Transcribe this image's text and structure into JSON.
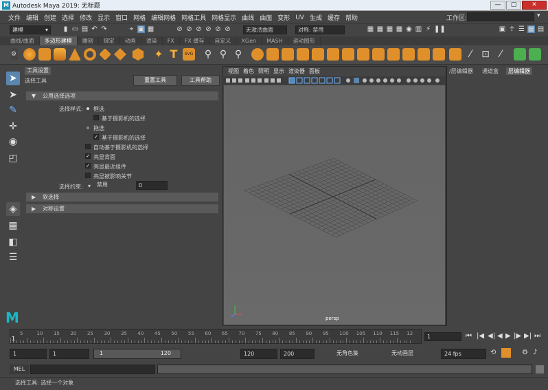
{
  "window": {
    "title": "Autodesk Maya 2019: 无标题",
    "min": "—",
    "max": "▢",
    "close": "✕"
  },
  "menubar": [
    "文件",
    "编辑",
    "创建",
    "选择",
    "修改",
    "显示",
    "窗口",
    "网格",
    "编辑网格",
    "网格工具",
    "网格显示",
    "曲线",
    "曲面",
    "变形",
    "UV",
    "生成",
    "缓存",
    "帮助"
  ],
  "workspace": {
    "label": "工作区:",
    "value": ""
  },
  "statusline": {
    "mode": "建模",
    "live_surface": "无激活曲面",
    "symmetry": "对称: 禁用"
  },
  "shelf_tabs": [
    "曲线/曲面",
    "多边形建模",
    "雕刻",
    "绑定",
    "动画",
    "渲染",
    "FX",
    "FX 缓存",
    "自定义",
    "XGen",
    "MASH",
    "运动图形"
  ],
  "shelf_active_tab": 1,
  "tool_settings": {
    "tab_label": "工具设置",
    "tool_name": "选择工具",
    "reset_button": "重置工具",
    "help_button": "工具帮助",
    "section_common": "公用选择选项",
    "selection_style_label": "选择样式:",
    "option_marquee": "框选",
    "option_camera_based_1": "基于摄影机的选择",
    "option_drag": "拖选",
    "option_camera_based_2": "基于摄影机的选择",
    "option_auto_camera": "自动基于摄影机的选择",
    "option_backface": "亮显背面",
    "option_nearest": "亮显最近组件",
    "option_affects_joints": "亮显被影响关节",
    "constraint_label": "选择约束:",
    "constraint_value": "禁用",
    "constraint_number": "0",
    "section_soft": "软选择",
    "section_symmetry": "对称设置"
  },
  "viewport": {
    "menu": [
      "视图",
      "着色",
      "照明",
      "显示",
      "渲染器",
      "面板"
    ],
    "camera_label": "persp"
  },
  "right_panel": {
    "tabs": [
      "/层编辑器",
      "通道盒",
      "层编辑器"
    ],
    "active": 2
  },
  "timeline": {
    "ticks": [
      "5",
      "10",
      "15",
      "20",
      "25",
      "30",
      "35",
      "40",
      "45",
      "50",
      "55",
      "60",
      "65",
      "70",
      "75",
      "80",
      "85",
      "90",
      "95",
      "100",
      "105",
      "110",
      "115",
      "12"
    ],
    "start_marker": "1",
    "current_frame": "1"
  },
  "range": {
    "start": "1",
    "playback_start": "1",
    "slider_left": "1",
    "slider_right": "120",
    "playback_end": "120",
    "end": "200",
    "character_set": "无角色集",
    "anim_layer": "无动画层",
    "fps": "24 fps"
  },
  "cmdline": {
    "label": "MEL"
  },
  "helpline": {
    "text": "选择工具: 选择一个对象"
  }
}
